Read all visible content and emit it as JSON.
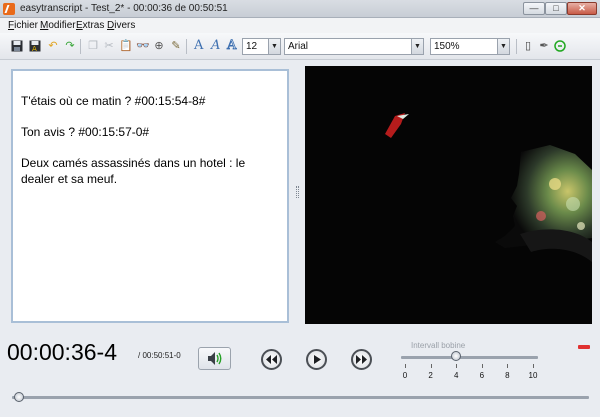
{
  "window": {
    "title": "easytranscript - Test_2* - 00:00:36 de 00:50:51",
    "minimize": "—",
    "maximize": "□",
    "close": "✕"
  },
  "menu": [
    {
      "mnemonic": "F",
      "rest": "ichier"
    },
    {
      "mnemonic": "M",
      "rest": "odifier"
    },
    {
      "mnemonic": "E",
      "rest": "xtras"
    },
    {
      "mnemonic": "D",
      "rest": "ivers"
    }
  ],
  "toolbar": {
    "icons": [
      "save-icon",
      "save-as-icon",
      "undo-icon",
      "redo-icon",
      "copy-icon",
      "cut-icon",
      "paste-icon",
      "find-icon",
      "spell-check-icon",
      "format-icon",
      "font-normal-icon",
      "font-italic-icon",
      "font-outline-icon",
      "phone-icon",
      "pen-icon",
      "sound-icon"
    ],
    "font_size": "12",
    "font_family": "Arial",
    "zoom": "150%",
    "colors": {
      "accent": "#3d6fb0",
      "undo": "#e0a423",
      "redo": "#3aa63a",
      "sound": "#22a822"
    }
  },
  "transcript": {
    "lines": [
      "T'étais où ce matin ? #00:15:54-8#",
      "Ton avis ? #00:15:57-0#",
      "Deux camés assassinés dans un hotel : le",
      "dealer et sa meuf."
    ]
  },
  "player": {
    "timecode": "00:00:36-4",
    "duration": "/ 00:50:51-0",
    "position_fraction": 0.012,
    "interval_label": "Intervall bobine",
    "interval_ticks": [
      "0",
      "2",
      "4",
      "6",
      "8",
      "10"
    ],
    "interval_value": 4,
    "interval_max": 10,
    "record_indicator_color": "#e03131"
  }
}
